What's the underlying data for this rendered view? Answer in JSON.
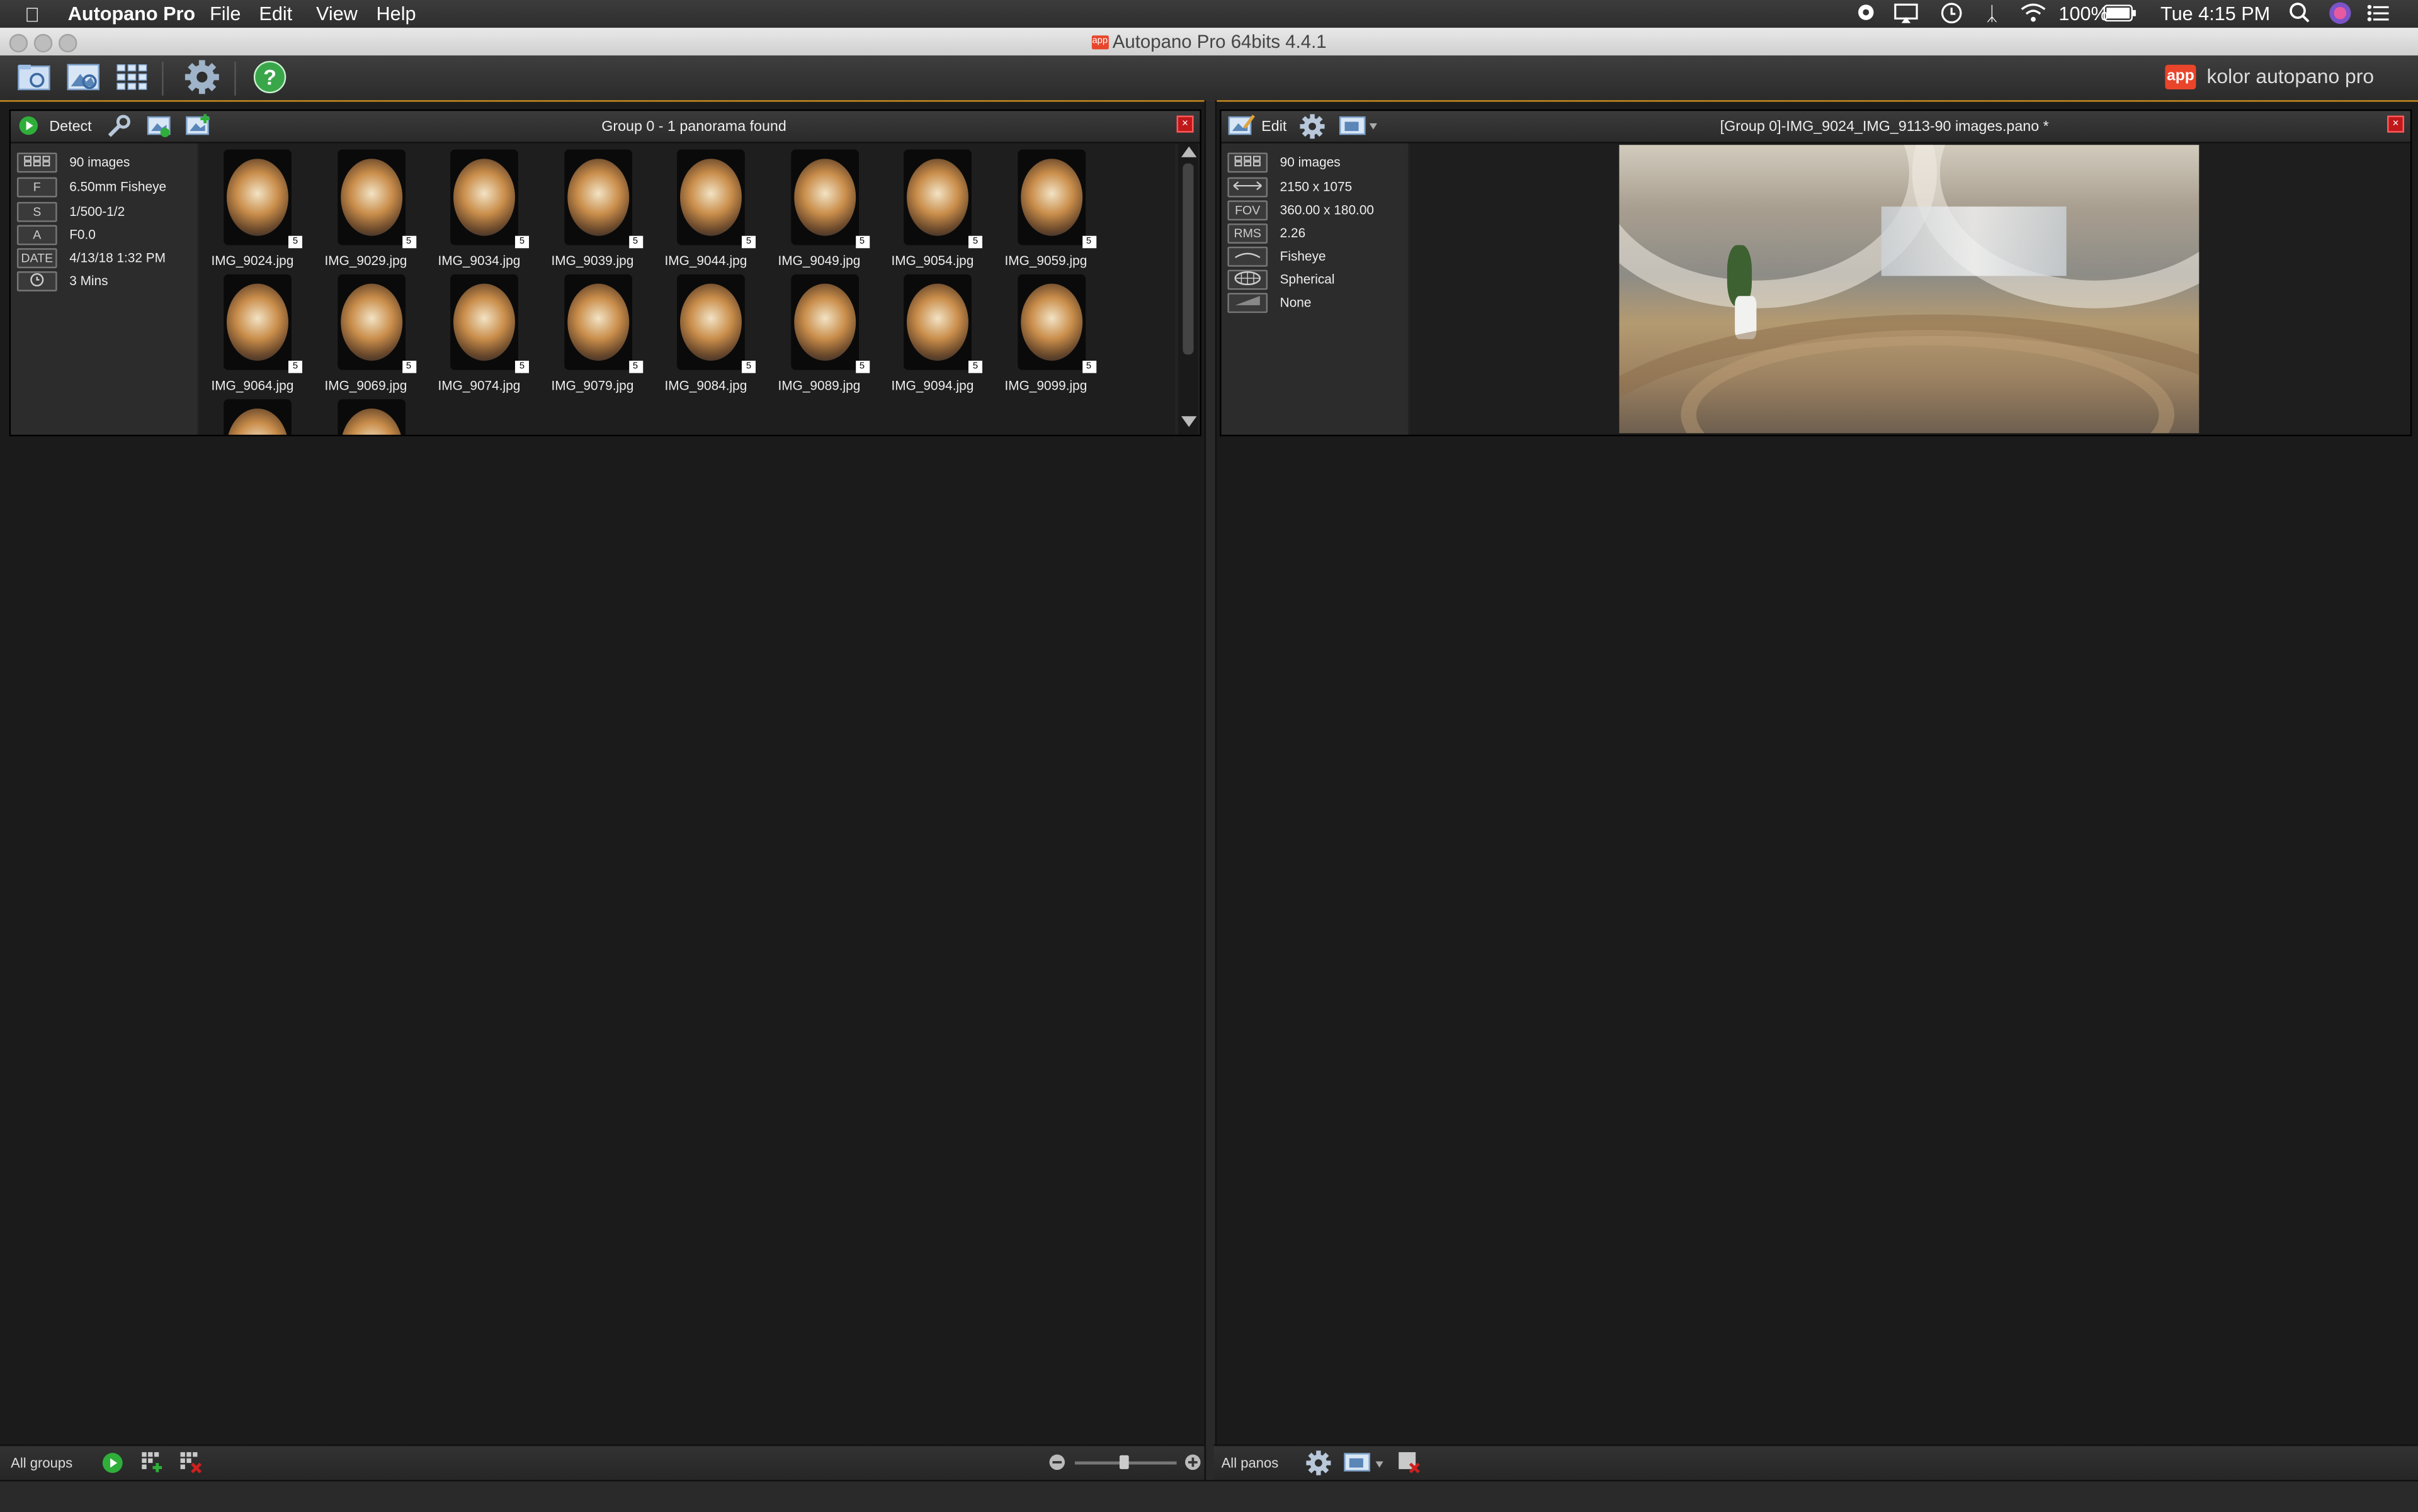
{
  "menubar": {
    "app_name": "Autopano Pro",
    "items": [
      "File",
      "Edit",
      "View",
      "Help"
    ],
    "battery": "100%",
    "clock": "Tue 4:15 PM"
  },
  "window": {
    "title": "Autopano Pro 64bits 4.4.1"
  },
  "brand": {
    "logo_text": "app",
    "name": "kolor autopano pro"
  },
  "toolbar": {
    "icons": [
      "open-folder-icon",
      "browse-images-icon",
      "grid-view-icon",
      "settings-gear-icon",
      "help-icon"
    ]
  },
  "groups_panel": {
    "detect_label": "Detect",
    "header": "Group 0 - 1 panorama found",
    "info": [
      {
        "badge": "",
        "value": "90 images"
      },
      {
        "badge": "F",
        "value": "6.50mm Fisheye"
      },
      {
        "badge": "S",
        "value": "1/500-1/2"
      },
      {
        "badge": "A",
        "value": "F0.0"
      },
      {
        "badge": "DATE",
        "value": "4/13/18 1:32 PM"
      },
      {
        "badge": "",
        "value": "3 Mins"
      }
    ],
    "thumbnails": [
      {
        "name": "IMG_9024.jpg",
        "badge": "5"
      },
      {
        "name": "IMG_9029.jpg",
        "badge": "5"
      },
      {
        "name": "IMG_9034.jpg",
        "badge": "5"
      },
      {
        "name": "IMG_9039.jpg",
        "badge": "5"
      },
      {
        "name": "IMG_9044.jpg",
        "badge": "5"
      },
      {
        "name": "IMG_9049.jpg",
        "badge": "5"
      },
      {
        "name": "IMG_9054.jpg",
        "badge": "5"
      },
      {
        "name": "IMG_9059.jpg",
        "badge": "5"
      },
      {
        "name": "IMG_9064.jpg",
        "badge": "5"
      },
      {
        "name": "IMG_9069.jpg",
        "badge": "5"
      },
      {
        "name": "IMG_9074.jpg",
        "badge": "5"
      },
      {
        "name": "IMG_9079.jpg",
        "badge": "5"
      },
      {
        "name": "IMG_9084.jpg",
        "badge": "5"
      },
      {
        "name": "IMG_9089.jpg",
        "badge": "5"
      },
      {
        "name": "IMG_9094.jpg",
        "badge": "5"
      },
      {
        "name": "IMG_9099.jpg",
        "badge": "5"
      }
    ],
    "footer_label": "All groups"
  },
  "panos_panel": {
    "edit_label": "Edit",
    "header": "[Group 0]-IMG_9024_IMG_9113-90 images.pano *",
    "info": [
      {
        "badge": "",
        "value": "90 images"
      },
      {
        "badge": "",
        "value": "2150 x 1075"
      },
      {
        "badge": "FOV",
        "value": "360.00 x 180.00"
      },
      {
        "badge": "RMS",
        "value": "2.26"
      },
      {
        "badge": "",
        "value": "Fisheye"
      },
      {
        "badge": "",
        "value": "Spherical"
      },
      {
        "badge": "",
        "value": "None"
      }
    ],
    "footer_label": "All panos"
  },
  "colors": {
    "accent": "#c98a20",
    "close": "#c0181a",
    "play_green": "#2fae3a"
  }
}
